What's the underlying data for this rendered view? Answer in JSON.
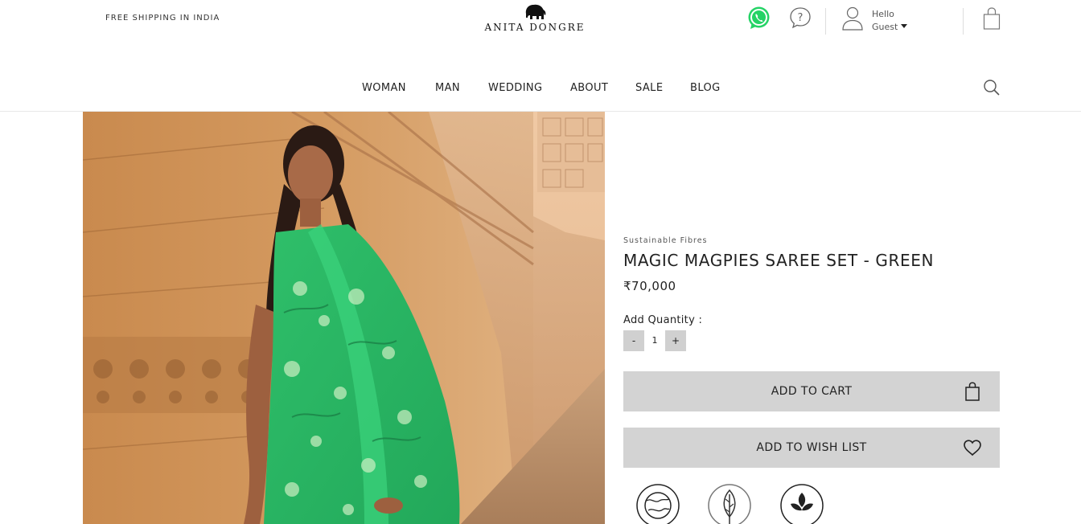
{
  "header": {
    "shipping_text": "FREE SHIPPING IN INDIA",
    "brand": "ANITA DONGRE",
    "greeting": "Hello",
    "user_name": "Guest"
  },
  "nav": {
    "items": [
      "WOMAN",
      "MAN",
      "WEDDING",
      "ABOUT",
      "SALE",
      "BLOG"
    ]
  },
  "product": {
    "category": "Sustainable Fibres",
    "title": "MAGIC MAGPIES SAREE SET - GREEN",
    "price": "₹70,000",
    "quantity_label": "Add Quantity :",
    "quantity": "1",
    "minus_label": "-",
    "plus_label": "+",
    "add_to_cart_label": "ADD TO CART",
    "add_to_wishlist_label": "ADD TO WISH LIST"
  },
  "icons": [
    "elephant-logo-icon",
    "whatsapp-icon",
    "help-icon",
    "user-icon",
    "shopping-bag-icon",
    "search-icon",
    "heart-icon",
    "globe-leaf-badge-icon",
    "leaf-badge-icon",
    "plant-badge-icon"
  ],
  "colors": {
    "whatsapp": "#25D366",
    "button_bg": "#d3d3d3",
    "saree_green": "#2fbf6a"
  }
}
